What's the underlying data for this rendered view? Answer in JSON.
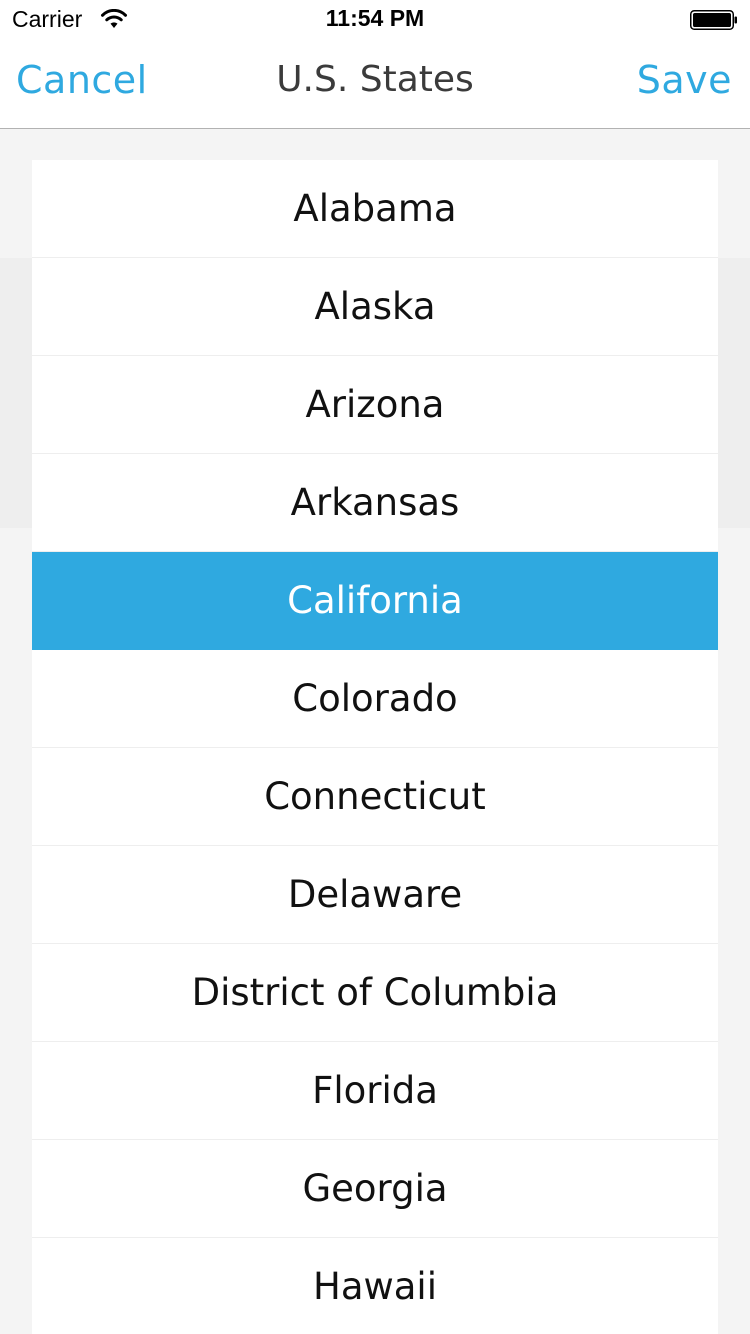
{
  "status_bar": {
    "carrier": "Carrier",
    "time": "11:54 PM",
    "wifi_icon": "wifi-icon",
    "battery_icon": "battery-icon"
  },
  "nav": {
    "cancel_label": "Cancel",
    "title": "U.S. States",
    "save_label": "Save"
  },
  "colors": {
    "accent": "#2fa9e0",
    "row_bg": "#ffffff",
    "page_bg": "#f4f4f4"
  },
  "list": {
    "selected_index": 4,
    "items": [
      {
        "label": "Alabama"
      },
      {
        "label": "Alaska"
      },
      {
        "label": "Arizona"
      },
      {
        "label": "Arkansas"
      },
      {
        "label": "California"
      },
      {
        "label": "Colorado"
      },
      {
        "label": "Connecticut"
      },
      {
        "label": "Delaware"
      },
      {
        "label": "District of Columbia"
      },
      {
        "label": "Florida"
      },
      {
        "label": "Georgia"
      },
      {
        "label": "Hawaii"
      }
    ]
  }
}
